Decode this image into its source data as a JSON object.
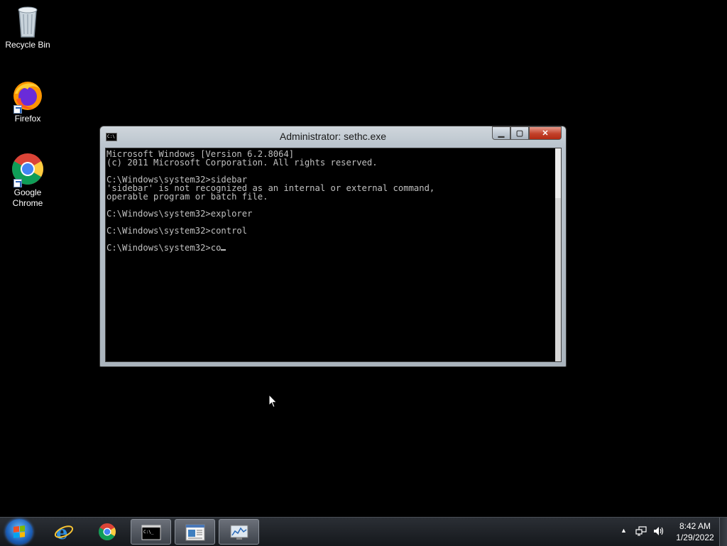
{
  "desktop": {
    "icons": [
      {
        "label": "Recycle Bin",
        "icon": "recycle-bin-icon"
      },
      {
        "label": "Firefox",
        "icon": "firefox-icon"
      },
      {
        "label": "Google\nChrome",
        "icon": "chrome-icon"
      }
    ]
  },
  "window": {
    "title": "Administrator: sethc.exe",
    "minimize": "▁",
    "maximize": "▢",
    "close": "✕"
  },
  "console": {
    "lines": [
      "Microsoft Windows [Version 6.2.8064]",
      "(c) 2011 Microsoft Corporation. All rights reserved.",
      "",
      "C:\\Windows\\system32>sidebar",
      "'sidebar' is not recognized as an internal or external command,",
      "operable program or batch file.",
      "",
      "C:\\Windows\\system32>explorer",
      "",
      "C:\\Windows\\system32>control",
      "",
      "C:\\Windows\\system32>co"
    ]
  },
  "taskbar": {
    "buttons": [
      {
        "name": "internet-explorer",
        "icon": "ie-icon"
      },
      {
        "name": "chrome",
        "icon": "chrome-icon"
      },
      {
        "name": "command-prompt",
        "icon": "cmd-icon",
        "active": true
      },
      {
        "name": "notepad-window",
        "icon": "window-icon"
      },
      {
        "name": "performance-monitor",
        "icon": "monitor-icon"
      }
    ],
    "tray": {
      "time": "8:42 AM",
      "date": "1/29/2022"
    }
  },
  "colors": {
    "desktop_bg": "#000000",
    "console_text": "#c0c0c0",
    "close_button": "#c3412a"
  }
}
